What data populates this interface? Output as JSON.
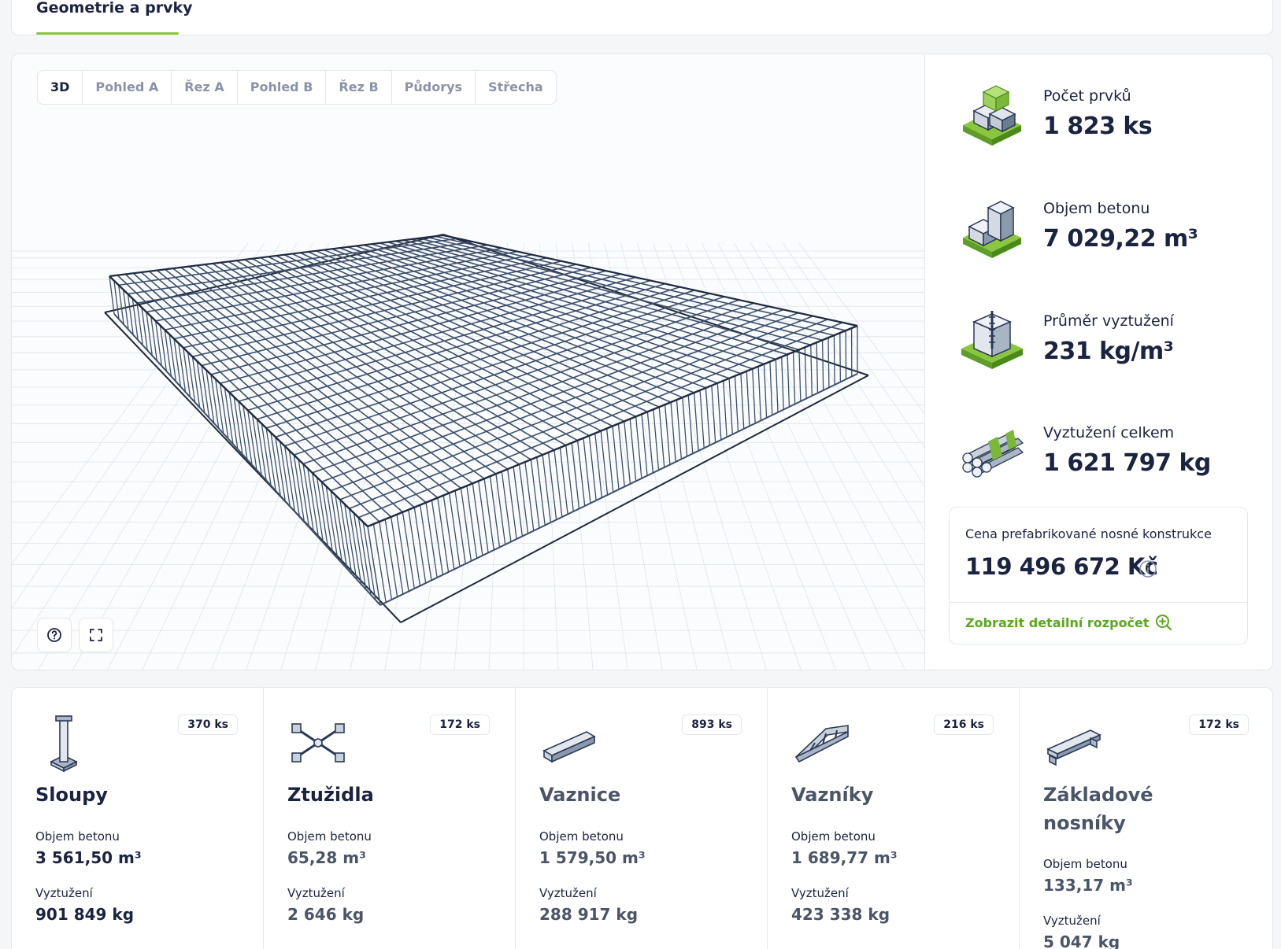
{
  "top_tab": {
    "label": "Geometrie a prvky"
  },
  "view_tabs": [
    {
      "label": "3D",
      "active": true
    },
    {
      "label": "Pohled A"
    },
    {
      "label": "Řez A"
    },
    {
      "label": "Pohled B"
    },
    {
      "label": "Řez B"
    },
    {
      "label": "Půdorys"
    },
    {
      "label": "Střecha"
    }
  ],
  "tools": {
    "help_icon": "help-circle-icon",
    "fullscreen_icon": "fullscreen-icon"
  },
  "stats": [
    {
      "label": "Počet prvků",
      "value": "1 823 ks",
      "icon": "blocks-icon"
    },
    {
      "label": "Objem betonu",
      "value": "7 029,22 m³",
      "icon": "concrete-cubes-icon"
    },
    {
      "label": "Průměr vyztužení",
      "value": "231 kg/m³",
      "icon": "reinforcement-column-icon"
    },
    {
      "label": "Vyztužení celkem",
      "value": "1 621 797 kg",
      "icon": "rebar-bundle-icon"
    }
  ],
  "price": {
    "label": "Cena prefabrikované nosné konstrukce",
    "value": "119 496 672 Kč",
    "link": "Zobrazit detailní rozpočet"
  },
  "colors": {
    "accent": "#8cc63f",
    "link": "#5aa81a",
    "text": "#1a2340",
    "frame": "#3c4f6b"
  },
  "elements": [
    {
      "name": "Sloupy",
      "count": "370 ks",
      "concrete_label": "Objem betonu",
      "concrete": "3 561,50 m³",
      "rebar_label": "Vyztužení",
      "rebar": "901 849 kg",
      "icon": "column-icon"
    },
    {
      "name": "Ztužidla",
      "count": "172 ks",
      "concrete_label": "Objem betonu",
      "concrete": "65,28 m³",
      "rebar_label": "Vyztužení",
      "rebar": "2 646 kg",
      "icon": "bracing-icon"
    },
    {
      "name": "Vaznice",
      "count": "893 ks",
      "concrete_label": "Objem betonu",
      "concrete": "1 579,50 m³",
      "rebar_label": "Vyztužení",
      "rebar": "288 917 kg",
      "icon": "purlin-icon"
    },
    {
      "name": "Vazníky",
      "count": "216 ks",
      "concrete_label": "Objem betonu",
      "concrete": "1 689,77 m³",
      "rebar_label": "Vyztužení",
      "rebar": "423 338 kg",
      "icon": "truss-icon"
    },
    {
      "name": "Základové nosníky",
      "count": "172 ks",
      "concrete_label": "Objem betonu",
      "concrete": "133,17 m³",
      "rebar_label": "Vyztužení",
      "rebar": "5 047 kg",
      "icon": "foundation-beam-icon"
    }
  ]
}
